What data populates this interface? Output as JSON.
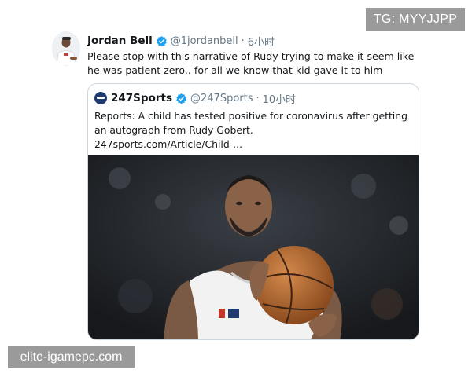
{
  "watermarks": {
    "top_right": "TG: MYYJJPP",
    "bottom_left": "elite-igamepc.com"
  },
  "tweet": {
    "author_name": "Jordan Bell",
    "handle": "@1jordanbell",
    "separator": "·",
    "time": "6小时",
    "text": "Please stop with this narrative of Rudy trying to make it seem like he was patient zero.. for all we know that kid gave it to him",
    "verified_icon": "verified-badge-icon",
    "avatar_icon": "profile-avatar"
  },
  "quoted_tweet": {
    "author_name": "247Sports",
    "handle": "@247Sports",
    "separator": "·",
    "time": "10小时",
    "text": "Reports: A child has tested positive for coronavirus after getting an autograph from Rudy Gobert.",
    "link": "247sports.com/Article/Child-...",
    "logo_icon": "247sports-logo",
    "verified_icon": "verified-badge-icon",
    "media": "basketball-player-photo"
  },
  "colors": {
    "text_primary": "#14171a",
    "text_secondary": "#657786",
    "verified": "#1da1f2",
    "card_border": "#ccd6dd",
    "watermark_bg": "#9a9a9a"
  }
}
